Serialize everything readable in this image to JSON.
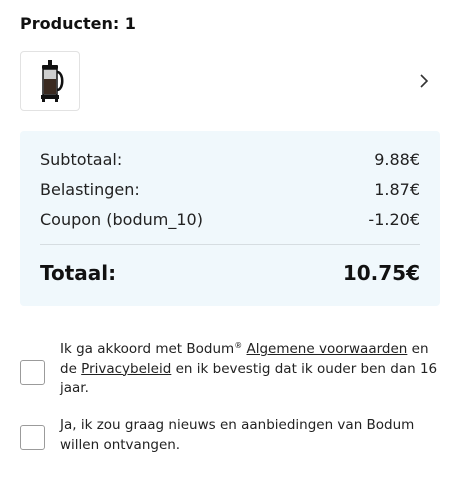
{
  "products": {
    "header": "Producten: 1",
    "thumbnail_icon": "french-press-icon",
    "expand_icon": "chevron-right-icon"
  },
  "summary": {
    "subtotal_label": "Subtotaal:",
    "subtotal_value": "9.88€",
    "taxes_label": "Belastingen:",
    "taxes_value": "1.87€",
    "coupon_label": "Coupon (bodum_10)",
    "coupon_value": "-1.20€",
    "total_label": "Totaal:",
    "total_value": "10.75€"
  },
  "consents": {
    "terms": {
      "text_before": "Ik ga akkoord met Bodum",
      "registered": "®",
      "terms_link": "Algemene voorwaarden",
      "text_middle": "en de",
      "privacy_link": "Privacybeleid",
      "text_after": "en ik bevestig dat ik ouder ben dan 16 jaar.",
      "checked": false
    },
    "newsletter": {
      "text": "Ja, ik zou graag nieuws en aanbiedingen van Bodum willen ontvangen.",
      "checked": false
    }
  },
  "colors": {
    "summary_background": "#f0f8fc",
    "text": "#1a1a1a"
  }
}
